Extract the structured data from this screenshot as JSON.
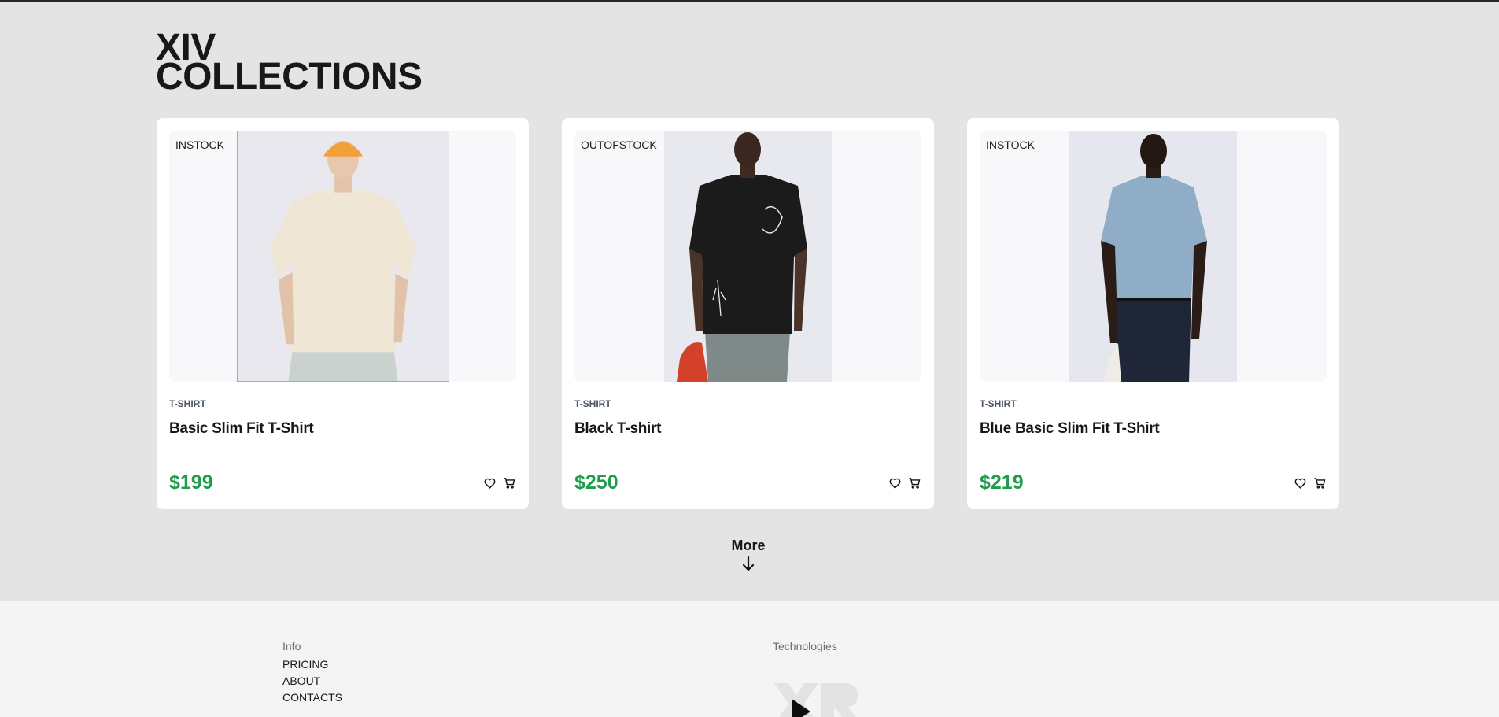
{
  "section": {
    "title_line1": "XIV",
    "title_line2": "COLLECTIONS"
  },
  "products": [
    {
      "stock": "INSTOCK",
      "category": "T-SHIRT",
      "name": "Basic Slim Fit T-Shirt",
      "price": "$199",
      "shirt_color": "#efe6d6",
      "cap_color": "#f2a03a"
    },
    {
      "stock": "OUTOFSTOCK",
      "category": "T-SHIRT",
      "name": "Black T-shirt",
      "price": "$250",
      "shirt_color": "#1b1b1b"
    },
    {
      "stock": "INSTOCK",
      "category": "T-SHIRT",
      "name": "Blue Basic Slim Fit T-Shirt",
      "price": "$219",
      "shirt_color": "#8fadc6"
    }
  ],
  "more": {
    "label": "More",
    "icon": "arrow-down-icon"
  },
  "footer": {
    "info_heading": "Info",
    "links": [
      "PRICING",
      "ABOUT",
      "CONTACTS"
    ],
    "tech_heading": "Technologies"
  },
  "colors": {
    "price": "#1f9d4c",
    "background": "#e5e4e5",
    "card": "#ffffff"
  }
}
